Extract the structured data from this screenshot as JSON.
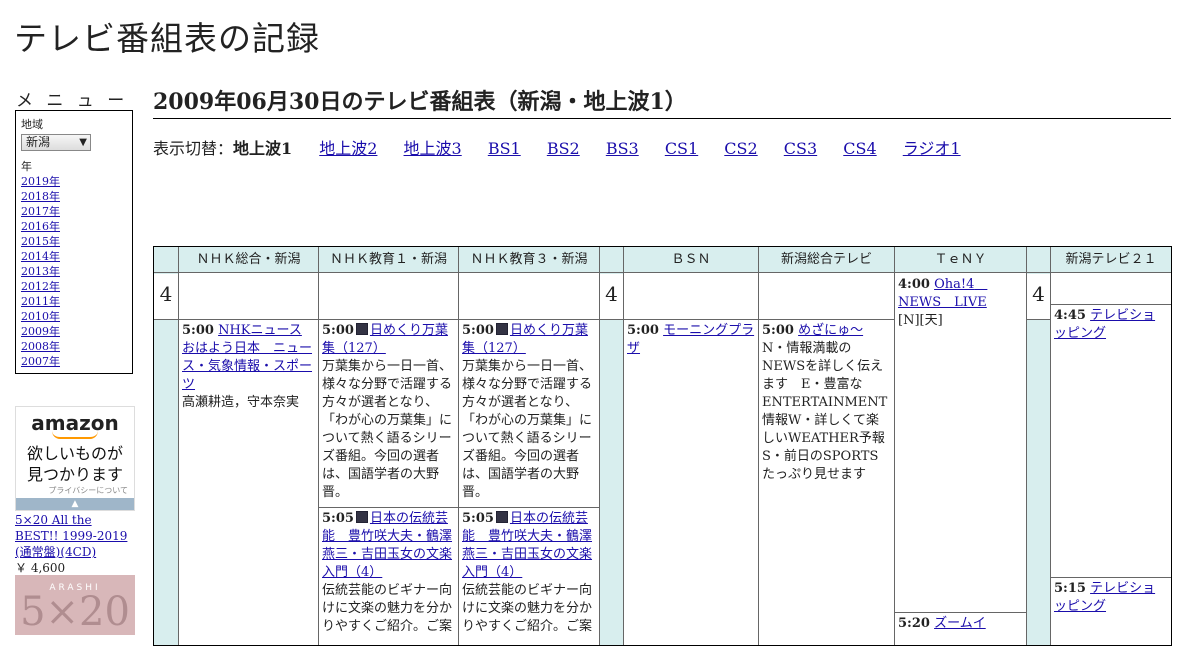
{
  "site_title": "テレビ番組表の記録",
  "menu": {
    "heading": "メ ニ ュ ー",
    "region_label": "地域",
    "region_value": "新潟",
    "year_label": "年",
    "years": [
      "2019年",
      "2018年",
      "2017年",
      "2016年",
      "2015年",
      "2014年",
      "2013年",
      "2012年",
      "2011年",
      "2010年",
      "2009年",
      "2008年",
      "2007年"
    ]
  },
  "ad": {
    "brand": "amazon",
    "copy_line1": "欲しいものが",
    "copy_line2": "見つかります",
    "privacy": "プライバシーについて",
    "product_title": "5×20 All the BEST!! 1999-2019 (通常盤)(4CD)",
    "product_price": "￥ 4,600",
    "product_image_text": "ARASHI",
    "product_image_big": "5×20"
  },
  "page": {
    "title": "2009年06月30日のテレビ番組表（新潟・地上波1）",
    "switch_label": "表示切替：",
    "switch_current": "地上波1",
    "switch_links": [
      "地上波2",
      "地上波3",
      "BS1",
      "BS2",
      "BS3",
      "CS1",
      "CS2",
      "CS3",
      "CS4",
      "ラジオ1"
    ]
  },
  "grid": {
    "hour": "4",
    "channels": [
      "ＮＨＫ総合・新潟",
      "ＮＨＫ教育１・新潟",
      "ＮＨＫ教育３・新潟",
      "ＢＳＮ",
      "新潟総合テレビ",
      "ＴｅＮＹ",
      "新潟テレビ２１"
    ],
    "programs": {
      "nhk_sogo": [
        {
          "time": "5:00",
          "title": "NHKニュース おはよう日本　ニュース・気象情報・スポーツ",
          "desc": "高瀬耕造，守本奈実"
        }
      ],
      "nhk_edu1": [
        {
          "time": "5:00",
          "title": "日めくり万葉集（127）",
          "desc": "万葉集から一日一首、様々な分野で活躍する方々が選者となり、「わが心の万葉集」について熱く語るシリーズ番組。今回の選者は、国語学者の大野晋。"
        },
        {
          "time": "5:05",
          "title": "日本の伝統芸能　豊竹咲大夫・鶴澤燕三・吉田玉女の文楽入門（4）",
          "desc": "伝統芸能のビギナー向けに文楽の魅力を分かりやすくご紹介。ご案"
        }
      ],
      "nhk_edu3": [
        {
          "time": "5:00",
          "title": "日めくり万葉集（127）",
          "desc": "万葉集から一日一首、様々な分野で活躍する方々が選者となり、「わが心の万葉集」について熱く語るシリーズ番組。今回の選者は、国語学者の大野晋。"
        },
        {
          "time": "5:05",
          "title": "日本の伝統芸能　豊竹咲大夫・鶴澤燕三・吉田玉女の文楽入門（4）",
          "desc": "伝統芸能のビギナー向けに文楽の魅力を分かりやすくご紹介。ご案"
        }
      ],
      "bsn": [
        {
          "time": "5:00",
          "title": "モーニングプラザ",
          "desc": ""
        }
      ],
      "nst": [
        {
          "time": "5:00",
          "title": "めざにゅ～",
          "desc": "N・情報満載のNEWSを詳しく伝えます　E・豊富なENTERTAINMENT情報W・詳しくて楽しいWEATHER予報　S・前日のSPORTSたっぷり見せます"
        }
      ],
      "teny": [
        {
          "time": "4:00",
          "title": "Oha!4　NEWS　LIVE",
          "desc": "[N][天]"
        },
        {
          "time": "5:20",
          "title": "ズームイ",
          "desc": ""
        }
      ],
      "ux": [
        {
          "time": "4:45",
          "title": "テレビショッピング",
          "desc": ""
        },
        {
          "time": "5:15",
          "title": "テレビショッピング",
          "desc": ""
        }
      ]
    }
  }
}
